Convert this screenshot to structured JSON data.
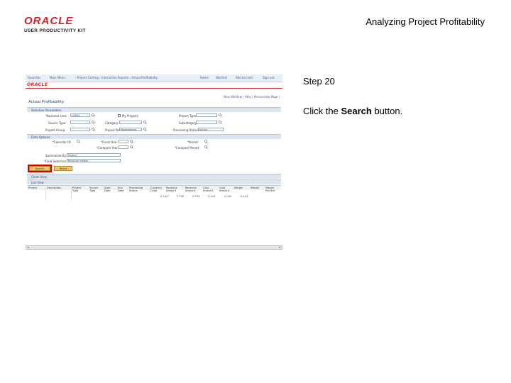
{
  "header": {
    "logo_main": "ORACLE",
    "logo_sub": "USER PRODUCTIVITY KIT",
    "doc_title": "Analyzing Project Profitability"
  },
  "step": {
    "number_text": "Step 20",
    "instruction_prefix": "Click the ",
    "instruction_target": "Search",
    "instruction_suffix": " button."
  },
  "screenshot": {
    "brand": "ORACLE",
    "page_title": "Actual Profitability",
    "top_links": "New Window | Help | Personalize Page | ",
    "sections": {
      "selection": "Selection Parameters",
      "display": "Data Options",
      "chart": "Chart View",
      "grid": "List View"
    },
    "buttons": {
      "search": "Search",
      "reset": "Reset"
    },
    "fields": {
      "business_unit_value": "US004",
      "project_role_value": "Maintenance",
      "processing_status_value": "Active",
      "sort_value": "Project",
      "group_value": "Revenue Viewer"
    },
    "grid_values": [
      "0.444",
      "1.338",
      "0.333",
      "0.404",
      "4.000",
      "0.444"
    ]
  },
  "colors": {
    "accent_red": "#d3222a",
    "highlight": "#d40000",
    "button_gold": "#f2c76b"
  }
}
